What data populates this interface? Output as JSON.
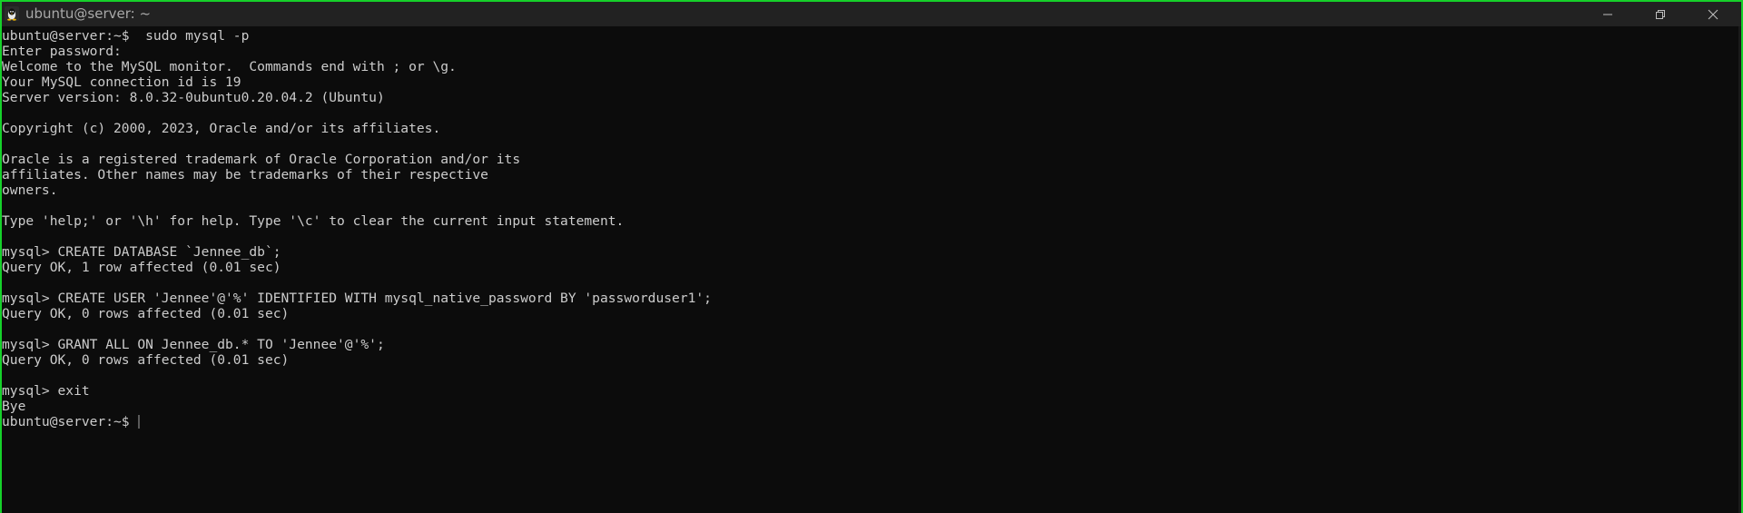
{
  "window": {
    "title": "ubuntu@server: ~",
    "app_icon": "linux-penguin-icon",
    "frame_color": "#16d12a",
    "controls": {
      "minimize": "minimize-icon",
      "maximize": "restore-icon",
      "close": "close-icon"
    }
  },
  "terminal": {
    "background": "#0c0c0c",
    "foreground": "#cccccc",
    "lines": [
      "ubuntu@server:~$  sudo mysql -p",
      "Enter password:",
      "Welcome to the MySQL monitor.  Commands end with ; or \\g.",
      "Your MySQL connection id is 19",
      "Server version: 8.0.32-0ubuntu0.20.04.2 (Ubuntu)",
      "",
      "Copyright (c) 2000, 2023, Oracle and/or its affiliates.",
      "",
      "Oracle is a registered trademark of Oracle Corporation and/or its",
      "affiliates. Other names may be trademarks of their respective",
      "owners.",
      "",
      "Type 'help;' or '\\h' for help. Type '\\c' to clear the current input statement.",
      "",
      "mysql> CREATE DATABASE `Jennee_db`;",
      "Query OK, 1 row affected (0.01 sec)",
      "",
      "mysql> CREATE USER 'Jennee'@'%' IDENTIFIED WITH mysql_native_password BY 'passworduser1';",
      "Query OK, 0 rows affected (0.01 sec)",
      "",
      "mysql> GRANT ALL ON Jennee_db.* TO 'Jennee'@'%';",
      "Query OK, 0 rows affected (0.01 sec)",
      "",
      "mysql> exit",
      "Bye"
    ],
    "prompt": "ubuntu@server:~$ "
  }
}
